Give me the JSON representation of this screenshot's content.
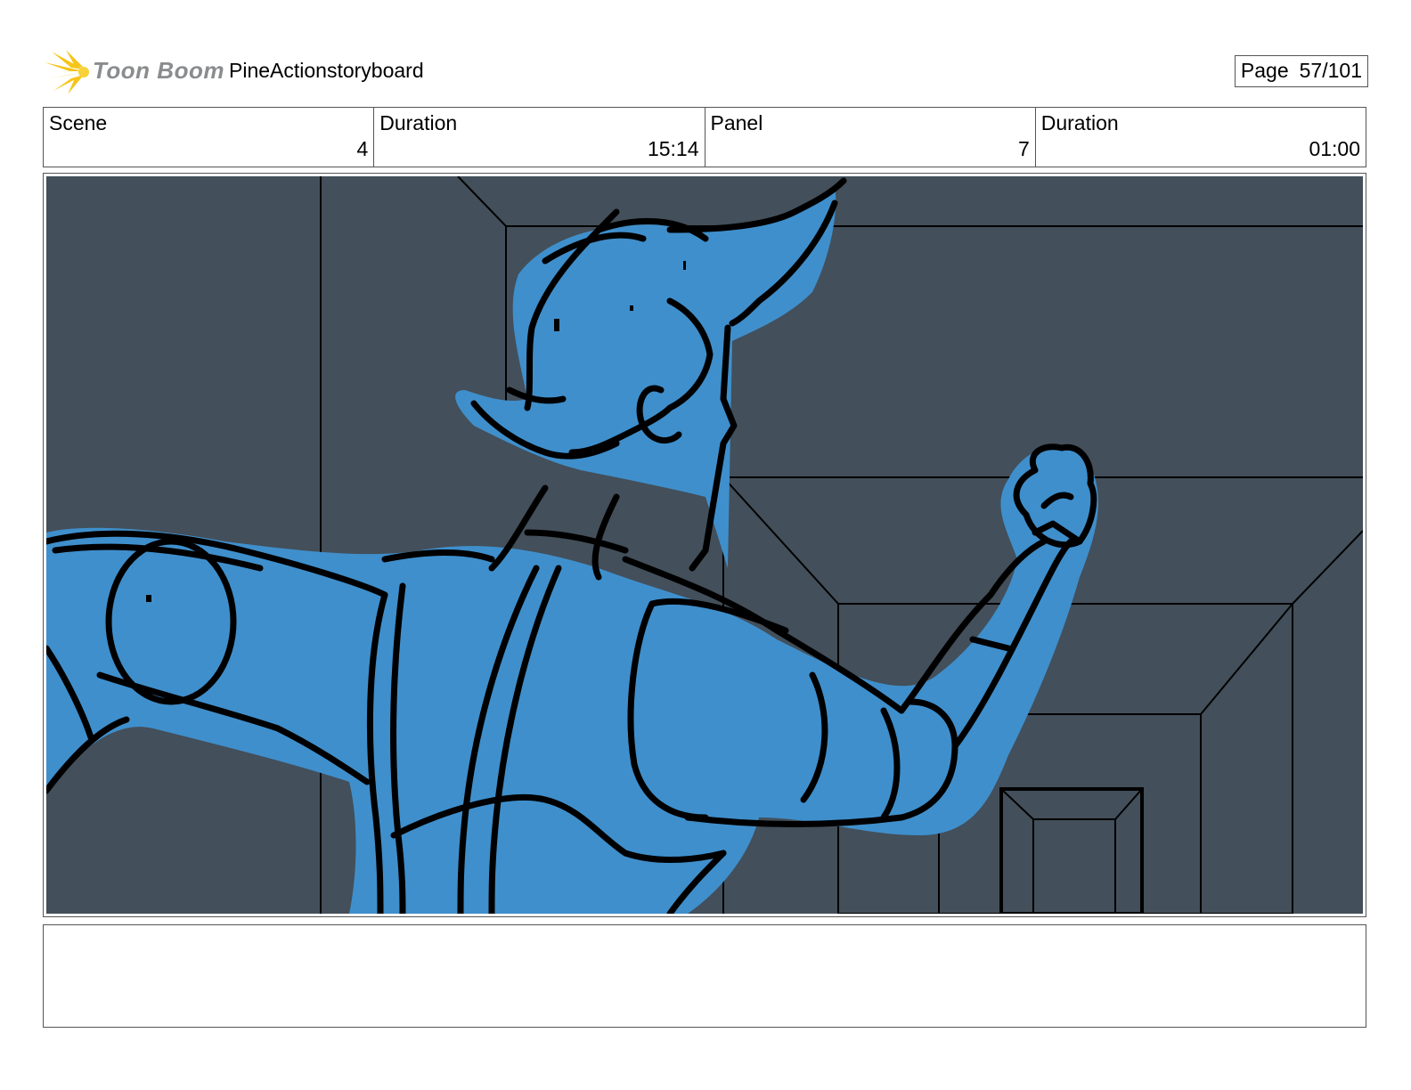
{
  "logo": {
    "text": "Toon Boom",
    "icon": "toon-boom-starburst-icon",
    "color_star": "#f5c518",
    "color_text": "#8a8c8e"
  },
  "project": {
    "title": "PineActionstoryboard"
  },
  "page": {
    "label": "Page",
    "number": "57/101"
  },
  "info": {
    "scene": {
      "label": "Scene",
      "value": "4"
    },
    "scene_duration": {
      "label": "Duration",
      "value": "15:14"
    },
    "panel": {
      "label": "Panel",
      "value": "7"
    },
    "panel_duration": {
      "label": "Duration",
      "value": "01:00"
    }
  },
  "drawing": {
    "description_icon": "character-punch-sketch",
    "colors": {
      "background": "#434f5a",
      "character_fill": "#3f8fcc",
      "ink": "#000000"
    }
  },
  "notes": {
    "text": ""
  }
}
